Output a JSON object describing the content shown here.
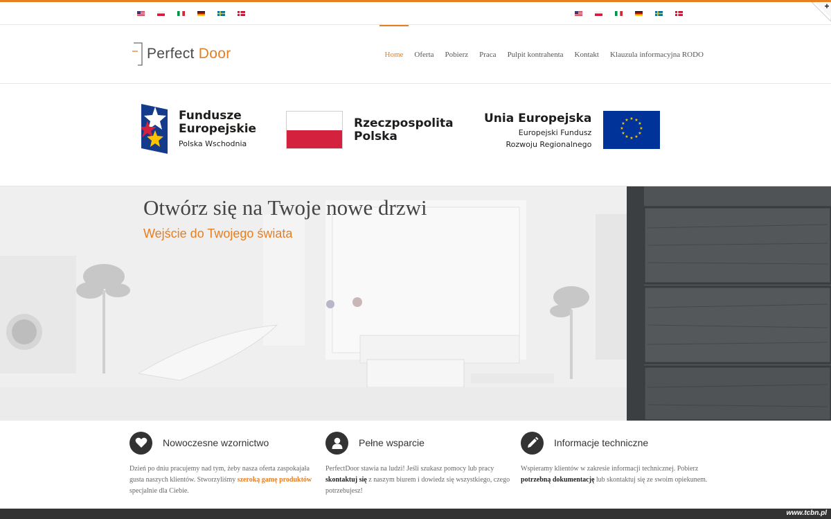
{
  "topbar": {
    "flags_left": [
      "en-flag-icon",
      "pl-flag-icon",
      "it-flag-icon",
      "de-flag-icon",
      "se-flag-icon",
      "dk-flag-icon"
    ],
    "flags_right": [
      "en-flag-icon",
      "pl-flag-icon",
      "it-flag-icon",
      "de-flag-icon",
      "se-flag-icon",
      "dk-flag-icon"
    ]
  },
  "logo": {
    "part1": "Perfect",
    "part2": "Door"
  },
  "nav": {
    "items": [
      {
        "label": "Home",
        "active": true
      },
      {
        "label": "Oferta"
      },
      {
        "label": "Pobierz"
      },
      {
        "label": "Praca"
      },
      {
        "label": "Pulpit kontrahenta"
      },
      {
        "label": "Kontakt"
      },
      {
        "label": "Klauzula informacyjna RODO"
      }
    ]
  },
  "eu_logos": {
    "fe": {
      "title1": "Fundusze",
      "title2": "Europejskie",
      "sub": "Polska Wschodnia"
    },
    "pl": {
      "line1": "Rzeczpospolita",
      "line2": "Polska"
    },
    "ue": {
      "title": "Unia Europejska",
      "sub1": "Europejski Fundusz",
      "sub2": "Rozwoju Regionalnego"
    }
  },
  "hero": {
    "title": "Otwórz się na Twoje nowe drzwi",
    "subtitle": "Wejście do Twojego świata"
  },
  "features": [
    {
      "icon": "heart-icon",
      "title": "Nowoczesne wzornictwo",
      "t1": "Dzień po dniu pracujemy nad tym, żeby nasza oferta zaspokajała gusta naszych klientów. Stworzyliśmy ",
      "link": "szeroką gamę produktów",
      "t2": " specjalnie dla Ciebie."
    },
    {
      "icon": "user-icon",
      "title": "Pełne wsparcie",
      "t1": "PerfectDoor stawia na ludzi! Jeśli szukasz pomocy lub pracy ",
      "link": "skontaktuj się",
      "t2": "  z naszym biurem i dowiedz się wszystkiego, czego potrzebujesz!"
    },
    {
      "icon": "pencil-icon",
      "title": "Informacje techniczne",
      "t1": "Wspieramy klientów w zakresie informacji technicznej. Pobierz ",
      "link": "potrzebną dokumentację",
      "t2": " lub skontaktuj się ze swoim opiekunem."
    }
  ],
  "footer": {
    "watermark": "www.tcbn.pl"
  },
  "colors": {
    "accent": "#e67e22",
    "dark": "#333333",
    "pl_red": "#d4213d",
    "eu_blue": "#003399",
    "eu_gold": "#ffcc00"
  }
}
